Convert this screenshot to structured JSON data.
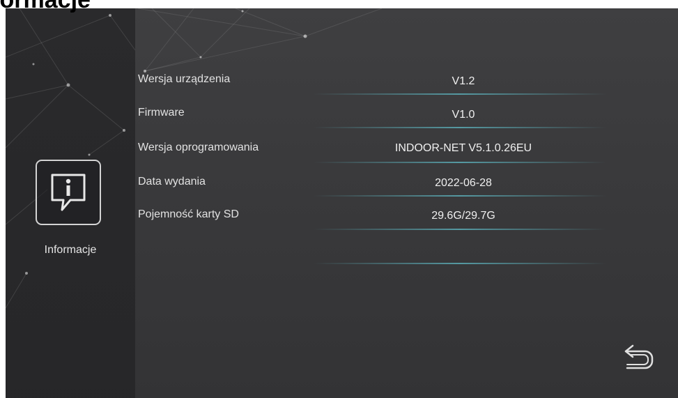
{
  "page": {
    "title": "Informacje"
  },
  "sidebar": {
    "item_label": "Informacje",
    "item_icon": "info-speech-bubble-icon"
  },
  "info_rows": [
    {
      "label": "Wersja urządzenia",
      "value": "V1.2"
    },
    {
      "label": "Firmware",
      "value": "V1.0"
    },
    {
      "label": "Wersja oprogramowania",
      "value": "INDOOR-NET V5.1.0.26EU"
    },
    {
      "label": "Data wydania",
      "value": "2022-06-28"
    },
    {
      "label": "Pojemność karty SD",
      "value": "29.6G/29.7G"
    }
  ],
  "controls": {
    "back_icon": "return-arrow-icon"
  },
  "colors": {
    "screen_background": "#3c3c3e",
    "sidebar_background": "#262628",
    "text": "#e6e6e6",
    "divider_accent": "#5aaab4"
  }
}
